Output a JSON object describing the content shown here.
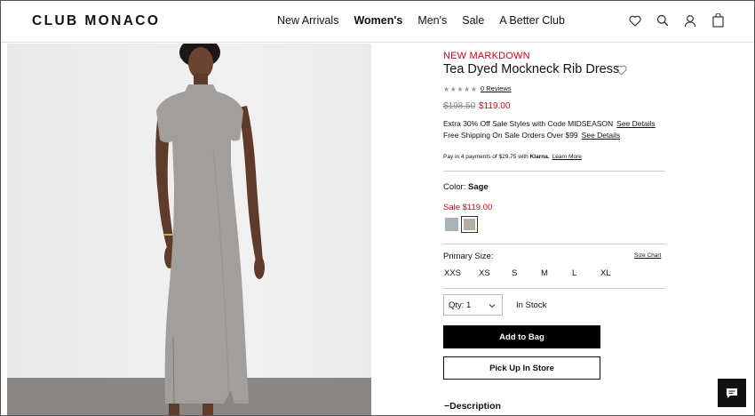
{
  "header": {
    "logo": "CLUB MONACO",
    "nav": [
      {
        "label": "New Arrivals",
        "active": false
      },
      {
        "label": "Women's",
        "active": true
      },
      {
        "label": "Men's",
        "active": false
      },
      {
        "label": "Sale",
        "active": false
      },
      {
        "label": "A Better Club",
        "active": false
      }
    ],
    "icons": [
      "heart-icon",
      "search-icon",
      "account-icon",
      "bag-icon"
    ]
  },
  "product": {
    "badge": "NEW MARKDOWN",
    "title": "Tea Dyed Mockneck Rib Dress",
    "stars": "★★★★★",
    "reviews": "0 Reviews",
    "original_price": "$198.50",
    "sale_price": "$119.00",
    "promo_line1": "Extra 30% Off Sale Styles with Code MIDSEASON",
    "promo_line1_link": "See Details",
    "promo_line2": "Free Shipping On Sale Orders Over $99",
    "promo_line2_link": "See Details",
    "klarna_pre": "Pay in 4 payments of $29.75 with",
    "klarna_brand": "Klarna.",
    "klarna_link": "Learn More",
    "color_label": "Color:",
    "color_value": "Sage",
    "sale_line": "Sale $119.00",
    "size_label": "Primary Size:",
    "size_chart": "Size Chart",
    "sizes": [
      "XXS",
      "XS",
      "S",
      "M",
      "L",
      "XL"
    ],
    "qty": "Qty: 1",
    "stock": "In Stock",
    "add_to_bag": "Add to Bag",
    "pickup": "Pick Up In Store",
    "description": "Description",
    "description_toggle": "−"
  },
  "colors": {
    "accent_red": "#d0021b",
    "swatch_1": "#a9b3b7",
    "swatch_2": "#b5aca2",
    "dress": "#a19e9c"
  }
}
